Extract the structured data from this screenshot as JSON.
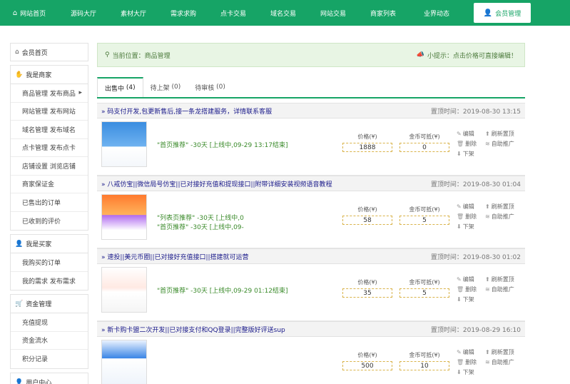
{
  "nav": {
    "items": [
      {
        "label": "网站首页",
        "icon": "home-icon"
      },
      {
        "label": "源码大厅"
      },
      {
        "label": "素材大厅"
      },
      {
        "label": "需求求购"
      },
      {
        "label": "点卡交易"
      },
      {
        "label": "域名交易"
      },
      {
        "label": "网站交易"
      },
      {
        "label": "商家列表"
      },
      {
        "label": "业界动态"
      },
      {
        "label": "会员管理",
        "icon": "user-icon",
        "active": true
      }
    ]
  },
  "sidebar": {
    "home": "会员首页",
    "groups": [
      {
        "title": "我是商家",
        "icon": "thumb-icon",
        "items": [
          "商品管理 发布商品",
          "网站管理 发布网站",
          "域名管理 发布域名",
          "点卡管理 发布点卡",
          "店铺设置 浏览店铺",
          "商家保证金",
          "已售出的订单",
          "已收到的评价"
        ]
      },
      {
        "title": "我是买家",
        "icon": "user-icon",
        "items": [
          "我购买的订单",
          "我的需求 发布需求"
        ]
      },
      {
        "title": "资金管理",
        "icon": "cart-icon",
        "items": [
          "充值提现",
          "资金流水",
          "积分记录"
        ]
      },
      {
        "title": "用户中心",
        "icon": "user-icon",
        "items": []
      }
    ]
  },
  "breadcrumb": {
    "label": "当前位置：商品管理",
    "tip": "小提示：点击价格可直接编辑！"
  },
  "tabs": [
    {
      "label": "出售中",
      "count": "(4)"
    },
    {
      "label": "待上架",
      "count": "(0)"
    },
    {
      "label": "待审核",
      "count": "(0)"
    }
  ],
  "listing_labels": {
    "price": "价格(¥)",
    "coin": "金币可抵(¥)",
    "ops": [
      "编辑",
      "刷新置顶",
      "删除",
      "自助推广",
      "下架"
    ]
  },
  "listings": [
    {
      "title": "» 码支付开发,包更新售后,接一条龙搭建服务，详情联系客服",
      "time": "置顶时间：2019-08-30 13:15",
      "rec": [
        "\"首页推荐\" -30天 [上线中,09-29 13:17结束]"
      ],
      "price": "1888",
      "coin": "0"
    },
    {
      "title": "» 八戒仿宝||微信局号仿宝||已对接好充值和提现接口||附带详细安装视频语音教程",
      "time": "置顶时间：2019-08-30 01:04",
      "rec": [
        "\"列表页推荐\" -30天 [上线中,0",
        "\"首页推荐\" -30天 [上线中,09-"
      ],
      "price": "58",
      "coin": "5"
    },
    {
      "title": "» 速投||美元币圈||已对接好充值接口||搭建就可运营",
      "time": "置顶时间：2019-08-30 01:02",
      "rec": [
        "\"首页推荐\" -30天 [上线中,09-29 01:12结束]"
      ],
      "price": "35",
      "coin": "5"
    },
    {
      "title": "» 新卡购卡盟二次开发||已对接支付和QQ登录||完整版好评送sup",
      "time": "置顶时间：2019-08-29 16:10",
      "rec": [],
      "price": "500",
      "coin": "10"
    }
  ]
}
